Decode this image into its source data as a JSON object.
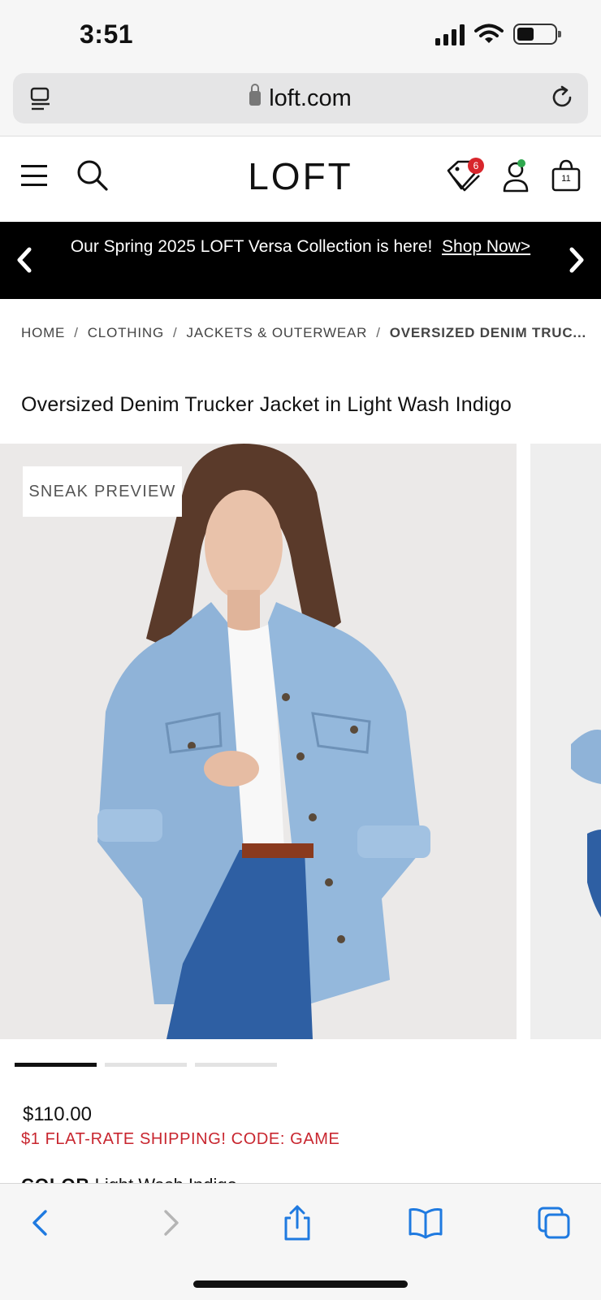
{
  "status_bar": {
    "time": "3:51"
  },
  "browser": {
    "url": "loft.com"
  },
  "header": {
    "logo": "LOFT",
    "tag_badge_count": "6",
    "bag_count": "11"
  },
  "promo": {
    "text": "Our Spring 2025 LOFT Versa Collection is here!",
    "link": "Shop Now>"
  },
  "breadcrumb": {
    "items": [
      "HOME",
      "CLOTHING",
      "JACKETS & OUTERWEAR"
    ],
    "current": "OVERSIZED DENIM TRUC..."
  },
  "product": {
    "title": "Oversized Denim Trucker Jacket in Light Wash Indigo",
    "badge": "SNEAK PREVIEW",
    "price": "$110.00",
    "shipping_promo": "$1 FLAT-RATE SHIPPING! CODE: GAME",
    "color_label": "COLOR",
    "color_value": "Light Wash Indigo",
    "image_count": 3,
    "active_image": 1
  },
  "colors": {
    "accent_red": "#c8262f",
    "badge_red": "#d8262c",
    "online_green": "#2fa84f",
    "safari_blue": "#1f7ae0"
  }
}
